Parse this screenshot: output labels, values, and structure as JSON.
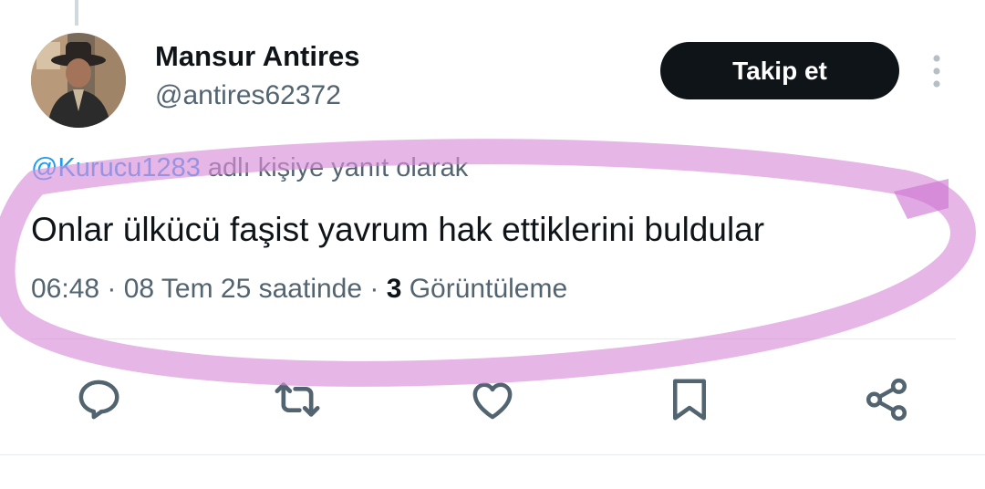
{
  "user": {
    "display_name": "Mansur Antires",
    "handle": "@antires62372"
  },
  "follow_button": {
    "label": "Takip et"
  },
  "reply_context": {
    "mention": "@Kurucu1283",
    "suffix": " adlı kişiye yanıt olarak"
  },
  "tweet": {
    "text": "Onlar ülkücü faşist yavrum hak ettiklerini buldular",
    "meta_prefix": "06:48 · 08 Tem 25 saatinde · ",
    "views_count": "3",
    "views_label": " Görüntüleme"
  },
  "actions": [
    {
      "icon": "reply-icon"
    },
    {
      "icon": "retweet-icon"
    },
    {
      "icon": "like-icon"
    },
    {
      "icon": "bookmark-icon"
    },
    {
      "icon": "share-icon"
    }
  ],
  "colors": {
    "text_primary": "#0f1419",
    "text_secondary": "#536471",
    "mention": "#1d9bf0",
    "button_bg": "#0f1419",
    "icon": "#536471",
    "highlight_annotation": "#d98fd8"
  }
}
